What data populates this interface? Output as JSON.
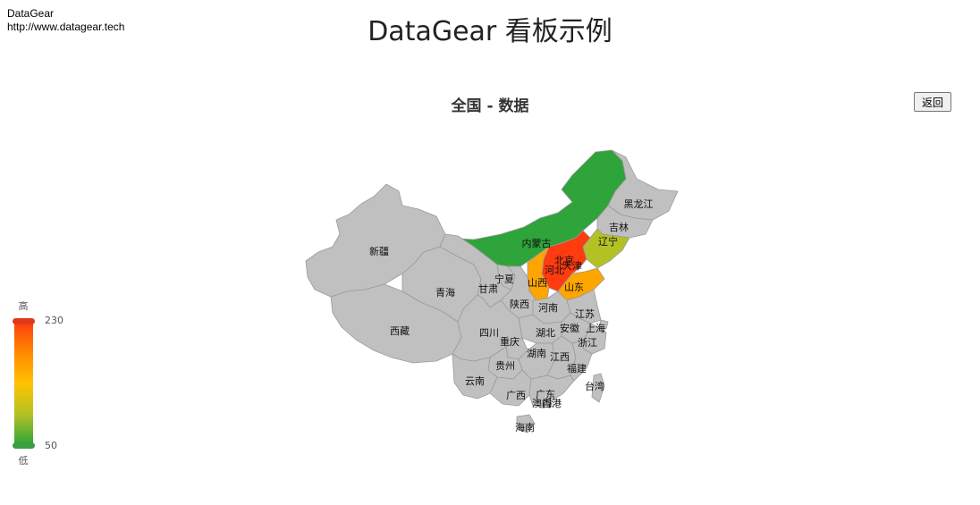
{
  "brand": {
    "name": "DataGear",
    "url": "http://www.datagear.tech"
  },
  "page_title": "DataGear 看板示例",
  "chart_title": "全国 - 数据",
  "back_label": "返回",
  "visual_map": {
    "high_label": "高",
    "low_label": "低",
    "max": 230,
    "min": 50,
    "max_text": "230",
    "min_text": "50"
  },
  "colors": {
    "no_data": "#c0c0c0",
    "green": "#2ea43a",
    "olive": "#b3c125",
    "orange": "#ffa500",
    "red": "#ff3b10"
  },
  "chart_data": {
    "type": "map",
    "region": "China",
    "title": "全国 - 数据",
    "visual_map": {
      "min": 50,
      "max": 230
    },
    "provinces": [
      {
        "name": "黑龙江",
        "value": null
      },
      {
        "name": "吉林",
        "value": null
      },
      {
        "name": "辽宁",
        "value": 100
      },
      {
        "name": "内蒙古",
        "value": 60
      },
      {
        "name": "北京",
        "value": 230
      },
      {
        "name": "天津",
        "value": 230
      },
      {
        "name": "河北",
        "value": 230
      },
      {
        "name": "山西",
        "value": 160
      },
      {
        "name": "山东",
        "value": 160
      },
      {
        "name": "新疆",
        "value": null
      },
      {
        "name": "青海",
        "value": null
      },
      {
        "name": "甘肃",
        "value": null
      },
      {
        "name": "宁夏",
        "value": null
      },
      {
        "name": "陕西",
        "value": null
      },
      {
        "name": "河南",
        "value": null
      },
      {
        "name": "江苏",
        "value": null
      },
      {
        "name": "安徽",
        "value": null
      },
      {
        "name": "上海",
        "value": null
      },
      {
        "name": "西藏",
        "value": null
      },
      {
        "name": "四川",
        "value": null
      },
      {
        "name": "湖北",
        "value": null
      },
      {
        "name": "浙江",
        "value": null
      },
      {
        "name": "重庆",
        "value": null
      },
      {
        "name": "湖南",
        "value": null
      },
      {
        "name": "江西",
        "value": null
      },
      {
        "name": "贵州",
        "value": null
      },
      {
        "name": "福建",
        "value": null
      },
      {
        "name": "云南",
        "value": null
      },
      {
        "name": "台湾",
        "value": null
      },
      {
        "name": "广西",
        "value": null
      },
      {
        "name": "广东",
        "value": null
      },
      {
        "name": "香港",
        "value": null
      },
      {
        "name": "澳门",
        "value": null
      },
      {
        "name": "海南",
        "value": null
      }
    ]
  }
}
